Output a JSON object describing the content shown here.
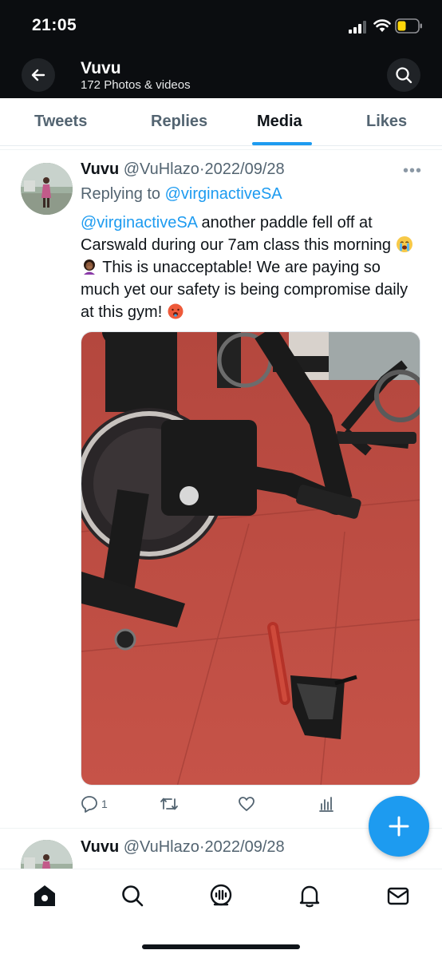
{
  "status_bar": {
    "time": "21:05"
  },
  "header": {
    "title": "Vuvu",
    "subtitle": "172 Photos & videos",
    "back_icon": "arrow-left-icon",
    "search_icon": "search-icon"
  },
  "tabs": [
    {
      "label": "Tweets",
      "active": false
    },
    {
      "label": "Replies",
      "active": false
    },
    {
      "label": "Media",
      "active": true
    },
    {
      "label": "Likes",
      "active": false
    }
  ],
  "tweets": [
    {
      "name": "Vuvu",
      "handle": "@VuHlazo",
      "separator": "·",
      "date": "2022/09/28",
      "replying_prefix": "Replying to ",
      "replying_to": "@virginactiveSA",
      "mention": "@virginactiveSA",
      "text_part1": " another paddle fell off at Carswald during our 7am class this morning ",
      "text_part2": " This is unacceptable! We are paying so much yet our safety is being compromise daily at this gym! ",
      "emojis": [
        "crying-face-emoji",
        "woman-facepalming-emoji",
        "hot-face-emoji"
      ],
      "reply_count": "1",
      "retweet_count": "",
      "like_count": ""
    },
    {
      "name": "Vuvu",
      "handle": "@VuHlazo",
      "separator": "·",
      "date": "2022/09/28"
    }
  ],
  "accent_color": "#1d9bf0",
  "bottom_nav": [
    "home-icon",
    "search-icon",
    "spaces-icon",
    "notifications-icon",
    "messages-icon"
  ]
}
